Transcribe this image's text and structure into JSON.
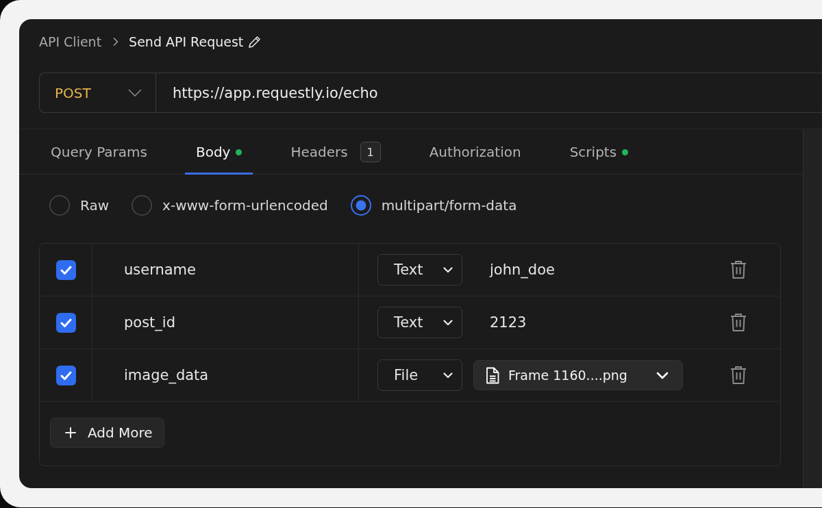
{
  "breadcrumb": {
    "parent": "API Client",
    "title": "Send API Request"
  },
  "request": {
    "method": "POST",
    "url": "https://app.requestly.io/echo"
  },
  "tabs": [
    {
      "label": "Query Params",
      "selected": false,
      "indicator": false
    },
    {
      "label": "Body",
      "selected": true,
      "indicator": true
    },
    {
      "label": "Headers",
      "selected": false,
      "indicator": false,
      "badge": "1"
    },
    {
      "label": "Authorization",
      "selected": false,
      "indicator": false
    },
    {
      "label": "Scripts",
      "selected": false,
      "indicator": true
    }
  ],
  "body_types": [
    {
      "label": "Raw",
      "selected": false
    },
    {
      "label": "x-www-form-urlencoded",
      "selected": false
    },
    {
      "label": "multipart/form-data",
      "selected": true
    }
  ],
  "form_rows": [
    {
      "checked": true,
      "key": "username",
      "type": "Text",
      "kind": "text",
      "value": "john_doe"
    },
    {
      "checked": true,
      "key": "post_id",
      "type": "Text",
      "kind": "text",
      "value": "2123"
    },
    {
      "checked": true,
      "key": "image_data",
      "type": "File",
      "kind": "file",
      "value": "Frame 1160....png"
    }
  ],
  "add_button": "Add More"
}
